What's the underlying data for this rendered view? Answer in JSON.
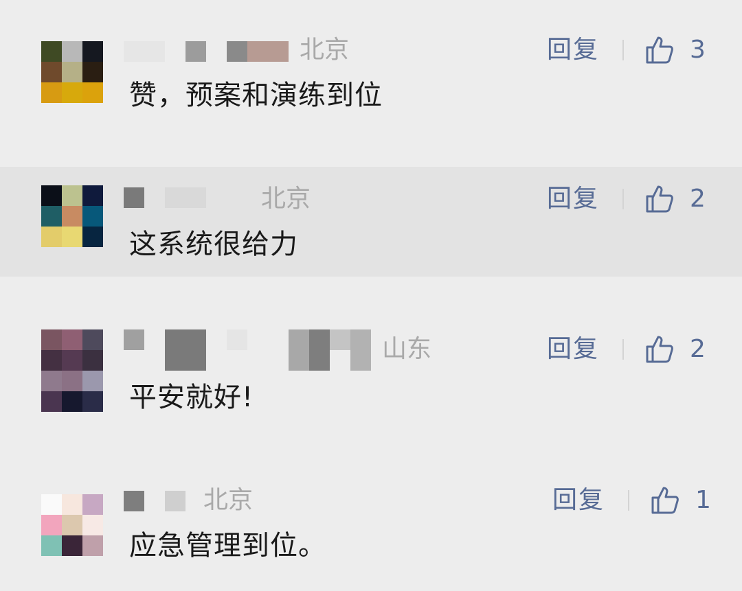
{
  "comments": [
    {
      "location": "北京",
      "text": "赞，预案和演练到位",
      "reply_label": "回复",
      "likes": "3",
      "avatar_colors": [
        "#3f4a24",
        "#b8b8b8",
        "#151820",
        "#6f4a2c",
        "#b5b087",
        "#2a1e12",
        "#d79b12",
        "#d7a90c",
        "#dba20c"
      ]
    },
    {
      "location": "北京",
      "text": "这系统很给力",
      "reply_label": "回复",
      "likes": "2",
      "avatar_colors": [
        "#0b0f18",
        "#bcc28f",
        "#0f1a3c",
        "#1f5e65",
        "#c88b62",
        "#07587a",
        "#e3cc6a",
        "#e8d872",
        "#072540"
      ]
    },
    {
      "location": "山东",
      "text": "平安就好!",
      "reply_label": "回复",
      "likes": "2",
      "avatar_colors": [
        "#7a5561",
        "#8f5f73",
        "#4e4a5c",
        "#443042",
        "#553a52",
        "#3b3040",
        "#8f7a8d",
        "#8b7185",
        "#9b98ad",
        "#4a3550",
        "#16182e",
        "#2a2c48"
      ]
    },
    {
      "location": "北京",
      "text": "应急管理到位。",
      "reply_label": "回复",
      "likes": "1",
      "avatar_colors": [
        "#fafafa",
        "#f7e7de",
        "#c7a8c3",
        "#f2a5bd",
        "#dcc8ae",
        "#f7e9e5",
        "#7fc1b4",
        "#3a2538",
        "#bfa0aa"
      ]
    }
  ],
  "colors": {
    "background": "#ededed",
    "highlight": "#e3e3e3",
    "link": "#576b95",
    "location": "#a9a9a9",
    "text": "#1a1a1a"
  },
  "icons": {
    "like": "thumbs-up-icon"
  }
}
